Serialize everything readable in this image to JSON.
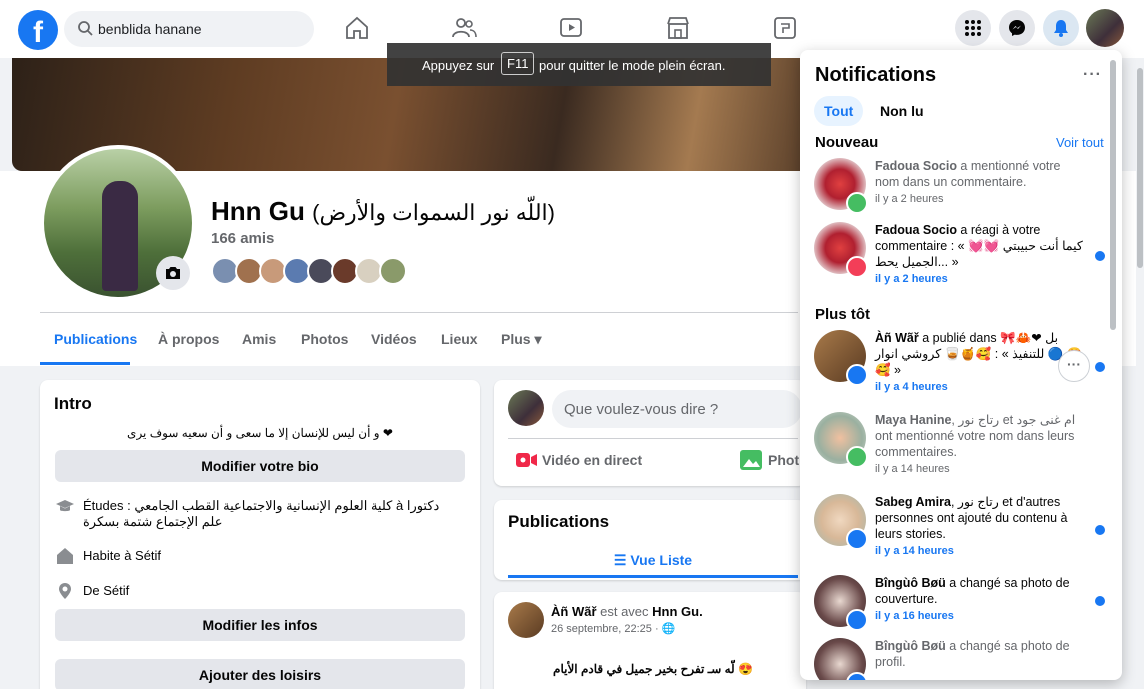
{
  "search": {
    "value": "benblida hanane"
  },
  "fullscreen": {
    "before": "Appuyez sur",
    "key": "F11",
    "after": "pour quitter le mode plein écran."
  },
  "profile": {
    "name": "Hnn Gu",
    "alt_name": "(اللّه نور السموات والأرض)",
    "friends": "166 amis"
  },
  "tabs": [
    {
      "label": "Publications"
    },
    {
      "label": "À propos"
    },
    {
      "label": "Amis"
    },
    {
      "label": "Photos"
    },
    {
      "label": "Vidéos"
    },
    {
      "label": "Lieux"
    },
    {
      "label": "Plus ▾"
    }
  ],
  "intro": {
    "title": "Intro",
    "bio": "و أن ليس للإنسان إلا ما سعى و أن سعيه سوف يرى ❤",
    "edit_bio": "Modifier votre bio",
    "study": "Études : كلية العلوم الإنسانية والاجتماعية القطب الجامعي à دكتورا علم الإجتماع شتمة بسكرة",
    "lives": "Habite à Sétif",
    "from": "De Sétif",
    "edit_info": "Modifier les infos",
    "add_hobbies": "Ajouter des loisirs"
  },
  "create_post": {
    "placeholder": "Que voulez-vous dire ?",
    "live": "Vidéo en direct",
    "photo": "Phot"
  },
  "publications": {
    "title": "Publications",
    "list_view": "☰ Vue Liste"
  },
  "post": {
    "author": "Àñ Wãř",
    "with": "est avec",
    "tagged": "Hnn Gu.",
    "date": "26 septembre, 22:25 · 🌐",
    "body": "لّه سـ تفرح بخير جميل في قادم الأيام 😍"
  },
  "notifications": {
    "title": "Notifications",
    "more": "···",
    "filter_all": "Tout",
    "filter_unread": "Non lu",
    "section_new": "Nouveau",
    "see_all": "Voir tout",
    "section_earlier": "Plus tôt",
    "items": [
      {
        "name": "Fadoua Socio",
        "text": " a mentionné votre nom dans un commentaire.",
        "time": "il y a 2 heures"
      },
      {
        "name": "Fadoua Socio",
        "text": " a réagi à votre commentaire : « كيما أنت حبيبتي 💓💓 الجميل يحط... »",
        "time": "il y a 2 heures"
      },
      {
        "name": "Àñ Wãř",
        "text": " a publié dans 🎀🦀❤ بل للتنفيذ » : 🥰🍯🥃 كروشي انوار 🔵 😍🥰 »",
        "time": "il y a 4 heures"
      },
      {
        "name": "Maya Hanine",
        "text": ", رتاج نور et ام غنى جود ont mentionné votre nom dans leurs commentaires.",
        "time": "il y a 14 heures"
      },
      {
        "name": "Sabeg Amira",
        "text": ", رتاج نور et d'autres personnes ont ajouté du contenu à leurs stories.",
        "time": "il y a 14 heures"
      },
      {
        "name": "Bîngùô Bøü",
        "text": " a changé sa photo de couverture.",
        "time": "il y a 16 heures"
      },
      {
        "name": "Bîngùô Bøü",
        "text": " a changé sa photo de profil.",
        "time": ""
      }
    ]
  },
  "colors": {
    "brand": "#1877f2",
    "background": "#f0f2f5"
  }
}
